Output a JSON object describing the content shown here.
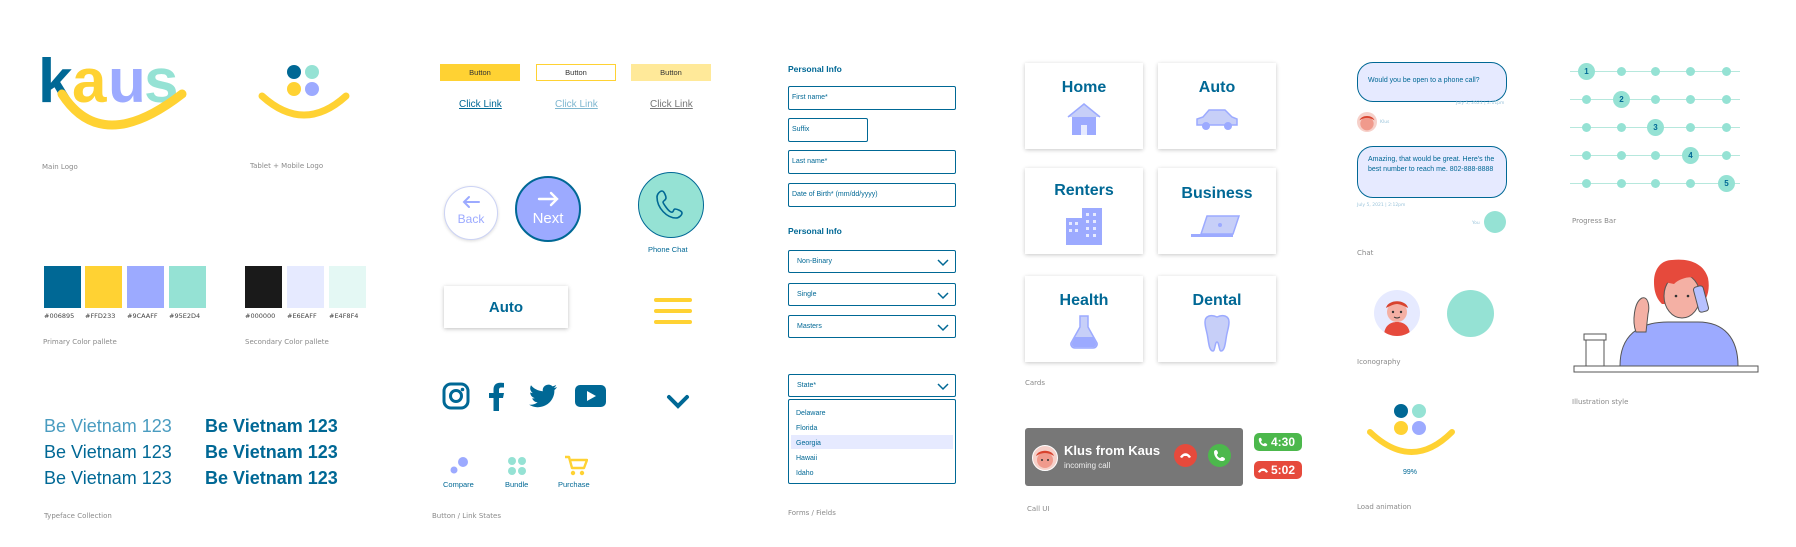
{
  "colors": {
    "blue": "#006895",
    "yellow": "#FFD233",
    "lavender": "#9CAAFF",
    "mint": "#95E2D4",
    "black": "#000000",
    "lightlavender": "#E6EAFF",
    "lightmint": "#E4F8F4",
    "grey": "#777777",
    "red": "#E64A3C",
    "green": "#4CB84C"
  },
  "logo": {
    "letters": [
      "k",
      "a",
      "u",
      "s"
    ],
    "main_caption": "Main Logo",
    "tablet_caption": "Tablet + Mobile Logo"
  },
  "palette": {
    "primary": [
      {
        "hex": "#006895",
        "label": "#006895"
      },
      {
        "hex": "#FFD233",
        "label": "#FFD233"
      },
      {
        "hex": "#9CAAFF",
        "label": "#9CAAFF"
      },
      {
        "hex": "#95E2D4",
        "label": "#95E2D4"
      }
    ],
    "primary_caption": "Primary Color pallete",
    "secondary": [
      {
        "hex": "#000000",
        "label": "#000000"
      },
      {
        "hex": "#E6EAFF",
        "label": "#E6EAFF"
      },
      {
        "hex": "#E4F8F4",
        "label": "#E4F8F4"
      }
    ],
    "secondary_caption": "Secondary Color pallete"
  },
  "typeface": {
    "sample": "Be Vietnam 123",
    "caption": "Typeface Collection"
  },
  "buttons": {
    "button_label": "Button",
    "link_label": "Click Link",
    "back_label": "Back",
    "next_label": "Next",
    "phone_chat_label": "Phone Chat",
    "auto_label": "Auto",
    "compare_label": "Compare",
    "bundle_label": "Bundle",
    "purchase_label": "Purchase",
    "caption": "Button / Link States"
  },
  "social_icons": [
    "instagram-icon",
    "facebook-icon",
    "twitter-icon",
    "youtube-icon"
  ],
  "forms": {
    "section1": "Personal Info",
    "first_name": "First name*",
    "suffix": "Suffix",
    "last_name": "Last name*",
    "dob": "Date of Birth* (mm/dd/yyyy)",
    "section2": "Personal Info",
    "gender": "Non-Binary",
    "marital": "Single",
    "education": "Masters",
    "state": "State*",
    "state_options": [
      "Delaware",
      "Florida",
      "Georgia",
      "Hawaii",
      "Idaho"
    ],
    "state_highlighted": "Georgia",
    "caption": "Forms / Fields"
  },
  "cards": {
    "home": "Home",
    "auto": "Auto",
    "renters": "Renters",
    "business": "Business",
    "health": "Health",
    "dental": "Dental",
    "caption": "Cards"
  },
  "call": {
    "name": "Klus from Kaus",
    "status": "incoming call",
    "timer_green": "4:30",
    "timer_red": "5:02",
    "caption": "Call UI"
  },
  "chat": {
    "msg1": "Would you be open to a phone call?",
    "msg1_time": "July 5, 2021 | 2:11pm",
    "sender1": "Klus",
    "msg2": "Amazing, that would be great. Here's the best number to reach me. 802-888-8888",
    "msg2_time": "July 5, 2021 | 2:12pm",
    "sender2": "You",
    "caption": "Chat"
  },
  "iconography_caption": "Iconography",
  "load": {
    "percent": "99%",
    "caption": "Load animation"
  },
  "progress": {
    "active_steps": [
      "1",
      "2",
      "3",
      "4",
      "5"
    ],
    "caption": "Progress Bar"
  },
  "illustration_caption": "Illustration style"
}
